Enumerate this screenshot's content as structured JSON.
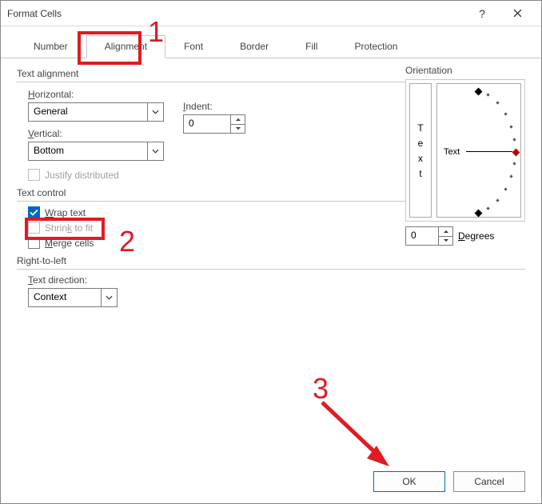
{
  "dialog": {
    "title": "Format Cells"
  },
  "tabs": {
    "items": [
      "Number",
      "Alignment",
      "Font",
      "Border",
      "Fill",
      "Protection"
    ],
    "active_index": 1
  },
  "text_alignment": {
    "group_label": "Text alignment",
    "horizontal_label": "Horizontal:",
    "horizontal_value": "General",
    "indent_label": "Indent:",
    "indent_value": "0",
    "vertical_label": "Vertical:",
    "vertical_value": "Bottom",
    "justify_label": "Justify distributed"
  },
  "text_control": {
    "group_label": "Text control",
    "wrap_label": "Wrap text",
    "wrap_checked": true,
    "shrink_label": "Shrink to fit",
    "merge_label": "Merge cells"
  },
  "rtl": {
    "group_label": "Right-to-left",
    "direction_label": "Text direction:",
    "direction_value": "Context"
  },
  "orientation": {
    "group_label": "Orientation",
    "vertical_text": "Text",
    "dial_text": "Text",
    "degrees_label": "Degrees",
    "degrees_value": "0"
  },
  "buttons": {
    "ok": "OK",
    "cancel": "Cancel"
  },
  "annotations": {
    "n1": "1",
    "n2": "2",
    "n3": "3"
  }
}
